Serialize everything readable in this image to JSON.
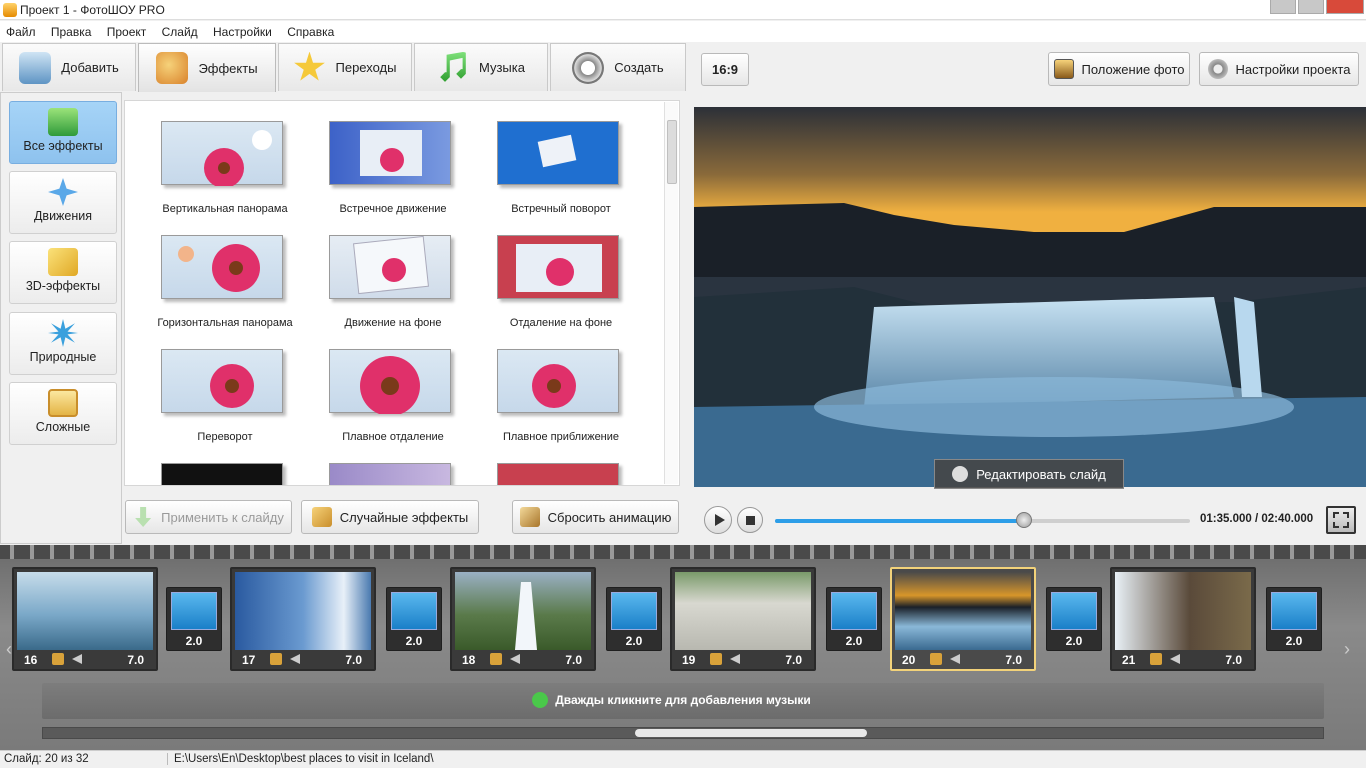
{
  "window": {
    "title": "Проект 1 - ФотоШОУ PRO"
  },
  "menu": [
    "Файл",
    "Правка",
    "Проект",
    "Слайд",
    "Настройки",
    "Справка"
  ],
  "tabs": [
    {
      "label": "Добавить",
      "icon": "camera-icon"
    },
    {
      "label": "Эффекты",
      "icon": "palette-icon",
      "active": true
    },
    {
      "label": "Переходы",
      "icon": "star-icon"
    },
    {
      "label": "Музыка",
      "icon": "music-note-icon"
    },
    {
      "label": "Создать",
      "icon": "film-reel-icon"
    }
  ],
  "categories": [
    {
      "label": "Все эффекты",
      "icon": "puzzle-icon",
      "active": true
    },
    {
      "label": "Движения",
      "icon": "move-arrows-icon"
    },
    {
      "label": "3D-эффекты",
      "icon": "cube-icon"
    },
    {
      "label": "Природные",
      "icon": "snowflake-icon"
    },
    {
      "label": "Сложные",
      "icon": "layers-icon"
    }
  ],
  "effects": [
    "Вертикальная панорама",
    "Встречное движение",
    "Встречный поворот",
    "Горизонтальная панорама",
    "Движение на фоне",
    "Отдаление на фоне",
    "Переворот",
    "Плавное отдаление",
    "Плавное приближение"
  ],
  "buttons": {
    "apply": "Применить к слайду",
    "random": "Случайные эффекты",
    "reset": "Сбросить анимацию"
  },
  "preview": {
    "aspect": "16:9",
    "photo_position": "Положение фото",
    "project_settings": "Настройки проекта",
    "edit_slide": "Редактировать слайд",
    "time": "01:35.000 / 02:40.000",
    "progress": 0.6
  },
  "slides": [
    {
      "num": "16",
      "duration": "7.0",
      "scene": "geyser-blue"
    },
    {
      "num": "17",
      "duration": "7.0",
      "scene": "geyser-spray"
    },
    {
      "num": "18",
      "duration": "7.0",
      "scene": "geyser-green"
    },
    {
      "num": "19",
      "duration": "7.0",
      "scene": "hot-springs"
    },
    {
      "num": "20",
      "duration": "7.0",
      "scene": "waterfall-sunset",
      "active": true
    },
    {
      "num": "21",
      "duration": "7.0",
      "scene": "waterfall-rainbow"
    }
  ],
  "transitions": [
    "2.0",
    "2.0",
    "2.0",
    "2.0",
    "2.0",
    "2.0"
  ],
  "timeline": {
    "music_hint": "Дважды кликните для добавления музыки"
  },
  "status": {
    "slide": "Слайд: 20 из 32",
    "path": "E:\\Users\\En\\Desktop\\best places to visit in Iceland\\"
  }
}
